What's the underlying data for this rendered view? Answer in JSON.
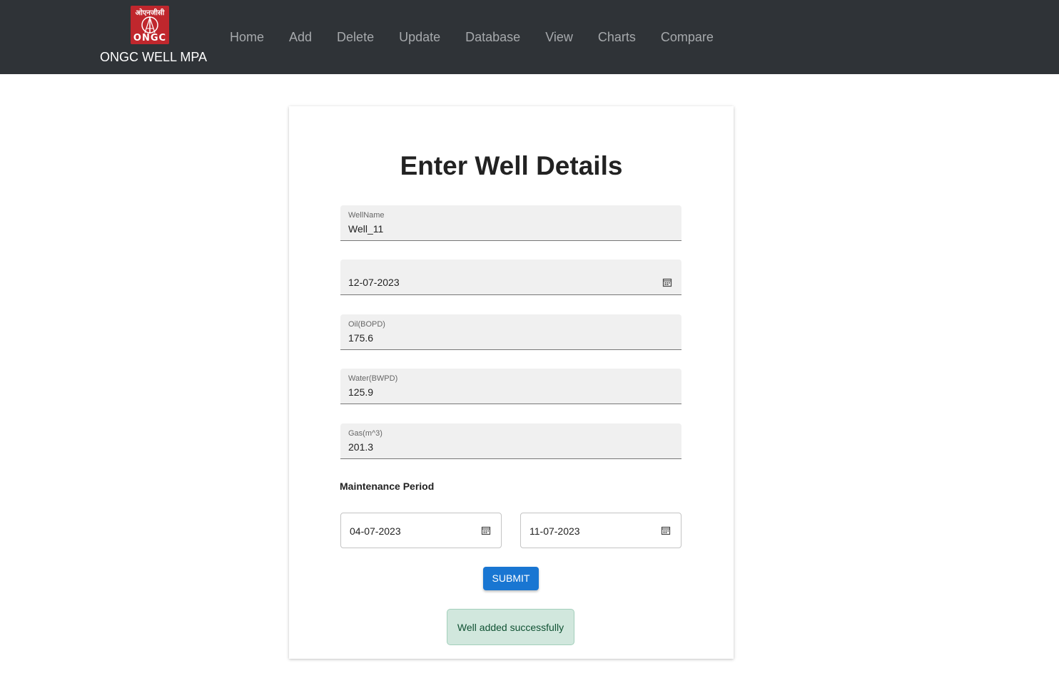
{
  "brand": {
    "logo_top_text": "ओएनजीसी",
    "logo_bottom_text": "ONGC",
    "name": "ONGC WELL MPA"
  },
  "nav": {
    "items": [
      "Home",
      "Add",
      "Delete",
      "Update",
      "Database",
      "View",
      "Charts",
      "Compare"
    ]
  },
  "form": {
    "title": "Enter Well Details",
    "well_name": {
      "label": "WellName",
      "value": "Well_11"
    },
    "date": {
      "value": "12-07-2023",
      "icon": "calendar-icon"
    },
    "oil": {
      "label": "Oil(BOPD)",
      "value": "175.6"
    },
    "water": {
      "label": "Water(BWPD)",
      "value": "125.9"
    },
    "gas": {
      "label": "Gas(m^3)",
      "value": "201.3"
    },
    "maintenance_label": "Maintenance Period",
    "maintenance_start": {
      "value": "04-07-2023",
      "icon": "calendar-icon"
    },
    "maintenance_end": {
      "value": "11-07-2023",
      "icon": "calendar-icon"
    },
    "submit_label": "SUBMIT",
    "success_message": "Well added successfully"
  },
  "colors": {
    "navbar": "#2f3337",
    "primary": "#1976d2",
    "logo": "#c0272d",
    "success_bg": "#d1e7dd"
  }
}
